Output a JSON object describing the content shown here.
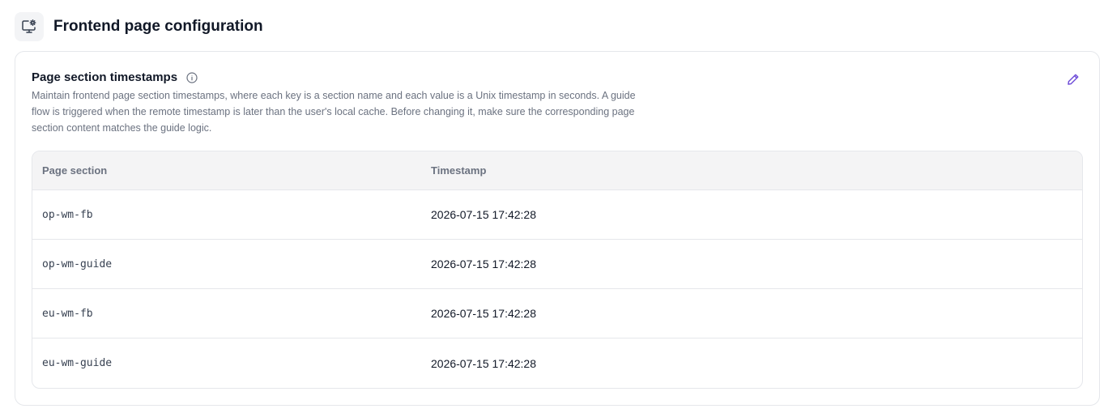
{
  "header": {
    "title": "Frontend page configuration",
    "icon": "monitor-settings-icon"
  },
  "card": {
    "title": "Page section timestamps",
    "info_icon": "info-icon",
    "edit_icon": "pencil-icon",
    "description": "Maintain frontend page section timestamps, where each key is a section name and each value is a Unix timestamp in seconds. A guide flow is triggered when the remote timestamp is later than the user's local cache. Before changing it, make sure the corresponding page section content matches the guide logic."
  },
  "table": {
    "columns": [
      "Page section",
      "Timestamp"
    ],
    "rows": [
      {
        "section": "op-wm-fb",
        "timestamp": "2026-07-15 17:42:28"
      },
      {
        "section": "op-wm-guide",
        "timestamp": "2026-07-15 17:42:28"
      },
      {
        "section": "eu-wm-fb",
        "timestamp": "2026-07-15 17:42:28"
      },
      {
        "section": "eu-wm-guide",
        "timestamp": "2026-07-15 17:42:28"
      }
    ]
  },
  "colors": {
    "accent": "#6d4bd8",
    "border": "#e5e7eb",
    "header_bg": "#f4f4f5"
  }
}
